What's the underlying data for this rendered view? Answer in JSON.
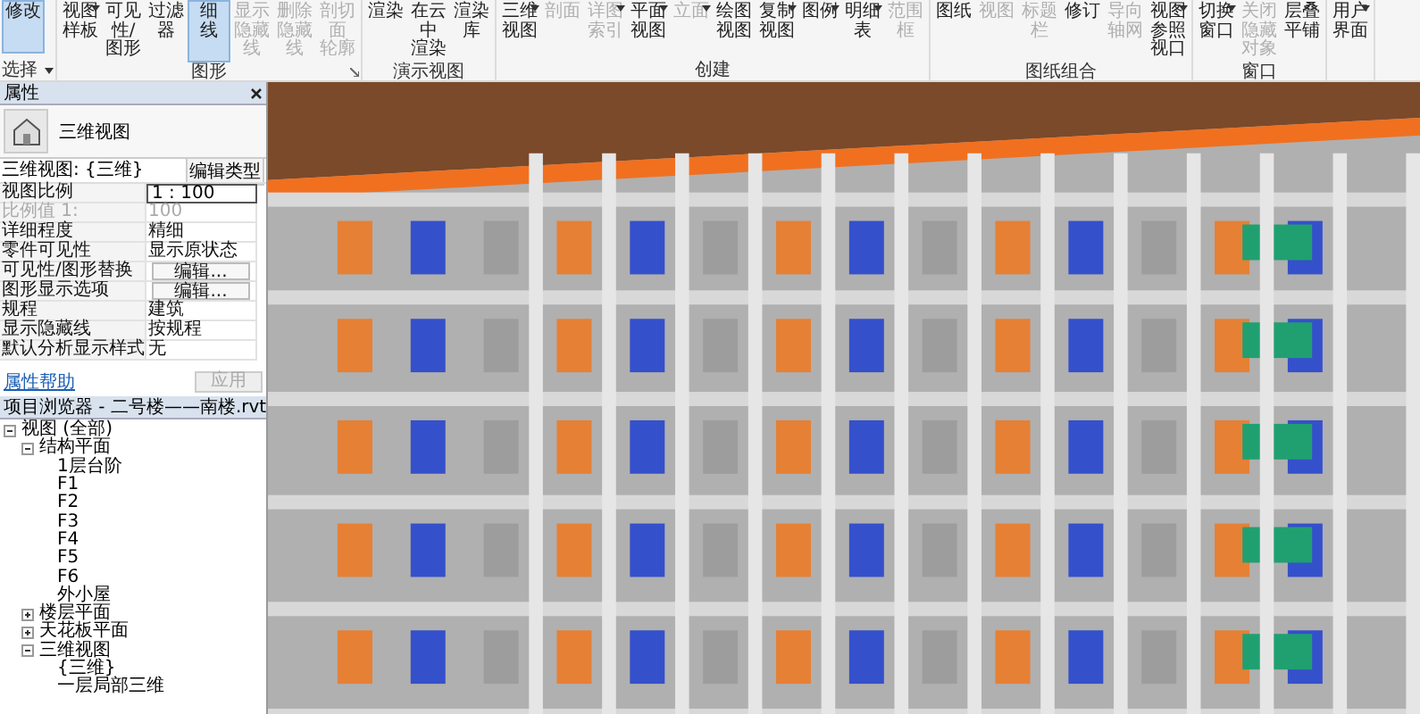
{
  "ribbon": {
    "select": {
      "button": "修改",
      "selected": true,
      "label": "选择"
    },
    "panels": [
      {
        "label": "图形",
        "launcher": true,
        "buttons": [
          {
            "lines": [
              "视图",
              "样板"
            ],
            "disabled": false,
            "selected": false,
            "dropdown": true
          },
          {
            "lines": [
              "可见性/",
              "图形"
            ],
            "disabled": false,
            "selected": false,
            "dropdown": false
          },
          {
            "lines": [
              "过滤器"
            ],
            "disabled": false,
            "selected": false,
            "dropdown": false
          },
          {
            "lines": [
              "细",
              "线"
            ],
            "disabled": false,
            "selected": true,
            "dropdown": false
          },
          {
            "lines": [
              "显示",
              "隐藏线"
            ],
            "disabled": true,
            "selected": false,
            "dropdown": false
          },
          {
            "lines": [
              "删除",
              "隐藏线"
            ],
            "disabled": true,
            "selected": false,
            "dropdown": false
          },
          {
            "lines": [
              "剖切面",
              "轮廓"
            ],
            "disabled": true,
            "selected": false,
            "dropdown": false
          }
        ]
      },
      {
        "label": "演示视图",
        "buttons": [
          {
            "lines": [
              "渲染"
            ],
            "disabled": false,
            "selected": false,
            "dropdown": false
          },
          {
            "lines": [
              "在云中",
              "渲染"
            ],
            "disabled": false,
            "selected": false,
            "dropdown": false
          },
          {
            "lines": [
              "渲染",
              "库"
            ],
            "disabled": false,
            "selected": false,
            "dropdown": false
          }
        ]
      },
      {
        "label": "创建",
        "buttons": [
          {
            "lines": [
              "三维",
              "视图"
            ],
            "disabled": false,
            "selected": false,
            "dropdown": true
          },
          {
            "lines": [
              "剖面"
            ],
            "disabled": true,
            "selected": false,
            "dropdown": false
          },
          {
            "lines": [
              "详图索引"
            ],
            "disabled": true,
            "selected": false,
            "dropdown": true
          },
          {
            "lines": [
              "平面",
              "视图"
            ],
            "disabled": false,
            "selected": false,
            "dropdown": true
          },
          {
            "lines": [
              "立面"
            ],
            "disabled": true,
            "selected": false,
            "dropdown": true
          },
          {
            "lines": [
              "绘图",
              "视图"
            ],
            "disabled": false,
            "selected": false,
            "dropdown": false
          },
          {
            "lines": [
              "复制",
              "视图"
            ],
            "disabled": false,
            "selected": false,
            "dropdown": true
          },
          {
            "lines": [
              "图例"
            ],
            "disabled": false,
            "selected": false,
            "dropdown": true
          },
          {
            "lines": [
              "明细表"
            ],
            "disabled": false,
            "selected": false,
            "dropdown": true
          },
          {
            "lines": [
              "范围",
              "框"
            ],
            "disabled": true,
            "selected": false,
            "dropdown": false
          }
        ]
      },
      {
        "label": "图纸组合",
        "buttons": [
          {
            "lines": [
              "图纸"
            ],
            "disabled": false,
            "selected": false,
            "dropdown": false
          },
          {
            "lines": [
              "视图"
            ],
            "disabled": true,
            "selected": false,
            "dropdown": false
          },
          {
            "lines": [
              "标题",
              "栏"
            ],
            "disabled": true,
            "selected": false,
            "dropdown": false
          },
          {
            "lines": [
              "修订"
            ],
            "disabled": false,
            "selected": false,
            "dropdown": false
          },
          {
            "lines": [
              "导向",
              "轴网"
            ],
            "disabled": true,
            "selected": false,
            "dropdown": false
          },
          {
            "lines": [
              "视图参照",
              "视口"
            ],
            "disabled": false,
            "selected": false,
            "dropdown": true
          }
        ]
      },
      {
        "label": "窗口",
        "buttons": [
          {
            "lines": [
              "切换",
              "窗口"
            ],
            "disabled": false,
            "selected": false,
            "dropdown": true
          },
          {
            "lines": [
              "关闭",
              "隐藏对象"
            ],
            "disabled": true,
            "selected": false,
            "dropdown": false
          },
          {
            "lines": [
              "层叠",
              "平铺"
            ],
            "disabled": false,
            "selected": false,
            "dropdown": false
          }
        ]
      },
      {
        "buttons": [
          {
            "lines": [
              "用户",
              "界面"
            ],
            "disabled": false,
            "selected": false,
            "dropdown": true
          }
        ]
      }
    ]
  },
  "properties": {
    "title": "属性",
    "type_name": "三维视图",
    "selector": "三维视图: {三维}",
    "edit_type": "编辑类型",
    "rows": [
      {
        "name": "视图比例",
        "value": "1 : 100",
        "kind": "input",
        "disabled": false
      },
      {
        "name": "比例值 1:",
        "value": "100",
        "kind": "text",
        "disabled": true
      },
      {
        "name": "详细程度",
        "value": "精细",
        "kind": "text",
        "disabled": false
      },
      {
        "name": "零件可见性",
        "value": "显示原状态",
        "kind": "text",
        "disabled": false
      },
      {
        "name": "可见性/图形替换",
        "value": "编辑...",
        "kind": "button",
        "disabled": false
      },
      {
        "name": "图形显示选项",
        "value": "编辑...",
        "kind": "button",
        "disabled": false
      },
      {
        "name": "规程",
        "value": "建筑",
        "kind": "text",
        "disabled": false
      },
      {
        "name": "显示隐藏线",
        "value": "按规程",
        "kind": "text",
        "disabled": false
      },
      {
        "name": "默认分析显示样式",
        "value": "无",
        "kind": "text",
        "disabled": false
      }
    ],
    "help_link": "属性帮助",
    "apply": "应用"
  },
  "browser": {
    "title": "项目浏览器 - 二号楼——南楼.rvt",
    "tree": [
      {
        "label": "视图 (全部)",
        "expanded": true,
        "children": [
          {
            "label": "结构平面",
            "expanded": true,
            "children": [
              {
                "label": "1层台阶"
              },
              {
                "label": "F1"
              },
              {
                "label": "F2"
              },
              {
                "label": "F3"
              },
              {
                "label": "F4"
              },
              {
                "label": "F5"
              },
              {
                "label": "F6"
              },
              {
                "label": "外小屋"
              }
            ]
          },
          {
            "label": "楼层平面",
            "expanded": false
          },
          {
            "label": "天花板平面",
            "expanded": false
          },
          {
            "label": "三维视图",
            "expanded": true,
            "children": [
              {
                "label": "{三维}"
              },
              {
                "label": "一层局部三维"
              }
            ]
          }
        ]
      }
    ]
  }
}
